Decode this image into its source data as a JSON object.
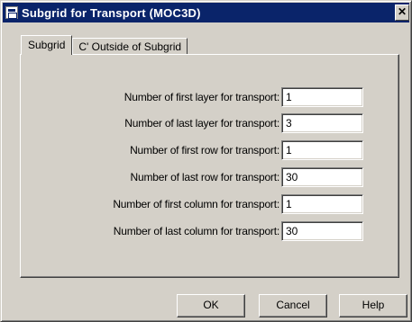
{
  "window": {
    "title": "Subgrid for Transport (MOC3D)",
    "close_label": "✕"
  },
  "tabs": [
    {
      "label": "Subgrid",
      "active": true
    },
    {
      "label": "C' Outside of Subgrid",
      "active": false
    }
  ],
  "fields": [
    {
      "label": "Number of first layer for transport:",
      "value": "1"
    },
    {
      "label": "Number of last layer for transport:",
      "value": "3"
    },
    {
      "label": "Number of first row for transport:",
      "value": "1"
    },
    {
      "label": "Number of last row for transport:",
      "value": "30"
    },
    {
      "label": "Number of first column for transport:",
      "value": "1"
    },
    {
      "label": "Number of last column for transport:",
      "value": "30"
    }
  ],
  "buttons": {
    "ok": "OK",
    "cancel": "Cancel",
    "help": "Help"
  },
  "colors": {
    "titlebar": "#0a246a",
    "face": "#d4d0c8"
  }
}
